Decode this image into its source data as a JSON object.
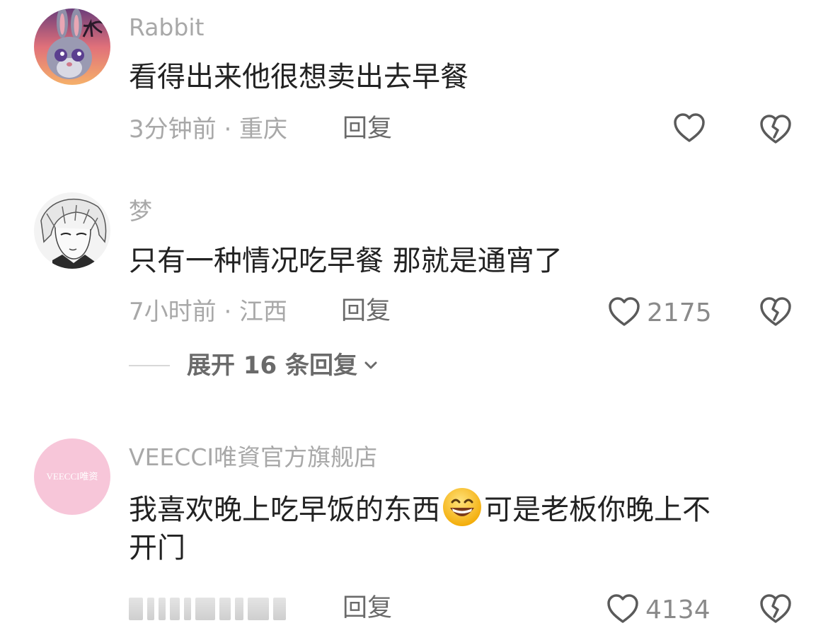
{
  "comments": [
    {
      "username": "Rabbit",
      "text": "看得出来他很想卖出去早餐",
      "meta": "3分钟前 · 重庆",
      "reply_label": "回复",
      "like_count": ""
    },
    {
      "username": "梦",
      "text": "只有一种情况吃早餐 那就是通宵了",
      "meta": "7小时前 · 江西",
      "reply_label": "回复",
      "like_count": "2175",
      "expand_label": "展开 16 条回复"
    },
    {
      "username": "VEECCI唯資官方旗舰店",
      "avatar_text": "VEECCI唯资",
      "text_part1": "我喜欢晚上吃早饭的东西",
      "text_part2": "可是老板你晚上不",
      "text_line2": "开门",
      "emoji": "grinning-face-emoji",
      "reply_label": "回复",
      "like_count": "4134"
    }
  ],
  "icons": {
    "like": "heart-outline-icon",
    "dislike": "broken-heart-icon",
    "expand": "chevron-down-icon"
  },
  "colors": {
    "username": "#a8a8a8",
    "text": "#222222",
    "meta": "#a8a8a8",
    "reply": "#6a6a6a",
    "icon": "#5a5a5a",
    "avatar3_bg": "#f7c6d9"
  }
}
